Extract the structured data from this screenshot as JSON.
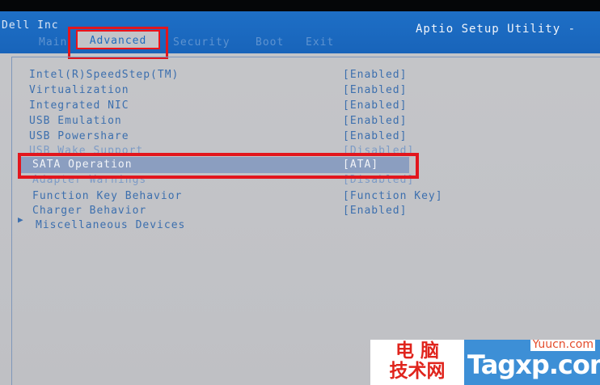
{
  "header": {
    "vendor": "Dell Inc",
    "utility": "Aptio Setup Utility -",
    "tabs": {
      "main": "Main",
      "advanced": "Advanced",
      "security": "Security",
      "boot": "Boot",
      "exit": "Exit"
    },
    "active_tab": "Advanced"
  },
  "settings": [
    {
      "label": "Intel(R)SpeedStep(TM)",
      "value": "[Enabled]"
    },
    {
      "label": "Virtualization",
      "value": "[Enabled]"
    },
    {
      "label": "Integrated NIC",
      "value": "[Enabled]"
    },
    {
      "label": "USB Emulation",
      "value": "[Enabled]"
    },
    {
      "label": "USB Powershare",
      "value": "[Enabled]"
    },
    {
      "label": "USB Wake Support",
      "value": "[Disabled]"
    },
    {
      "label": "SATA Operation",
      "value": "[ATA]"
    },
    {
      "label": "Adapter Warnings",
      "value": "[Disabled]"
    },
    {
      "label": "Function Key Behavior",
      "value": "[Function Key]"
    },
    {
      "label": "Charger Behavior",
      "value": "[Enabled]"
    }
  ],
  "selected_setting": "SATA Operation",
  "submenu": {
    "label": "Miscellaneous Devices",
    "icon": "triangle-right-icon"
  },
  "watermark": {
    "chinese_line1": "电 脑",
    "chinese_line2": "技术网",
    "site_small": "Yuucn.com",
    "site_large": "Tagxp.com"
  },
  "colors": {
    "header_blue": "#1e6fc6",
    "text_blue": "#3c6fae",
    "highlight_red": "#e2161d"
  }
}
